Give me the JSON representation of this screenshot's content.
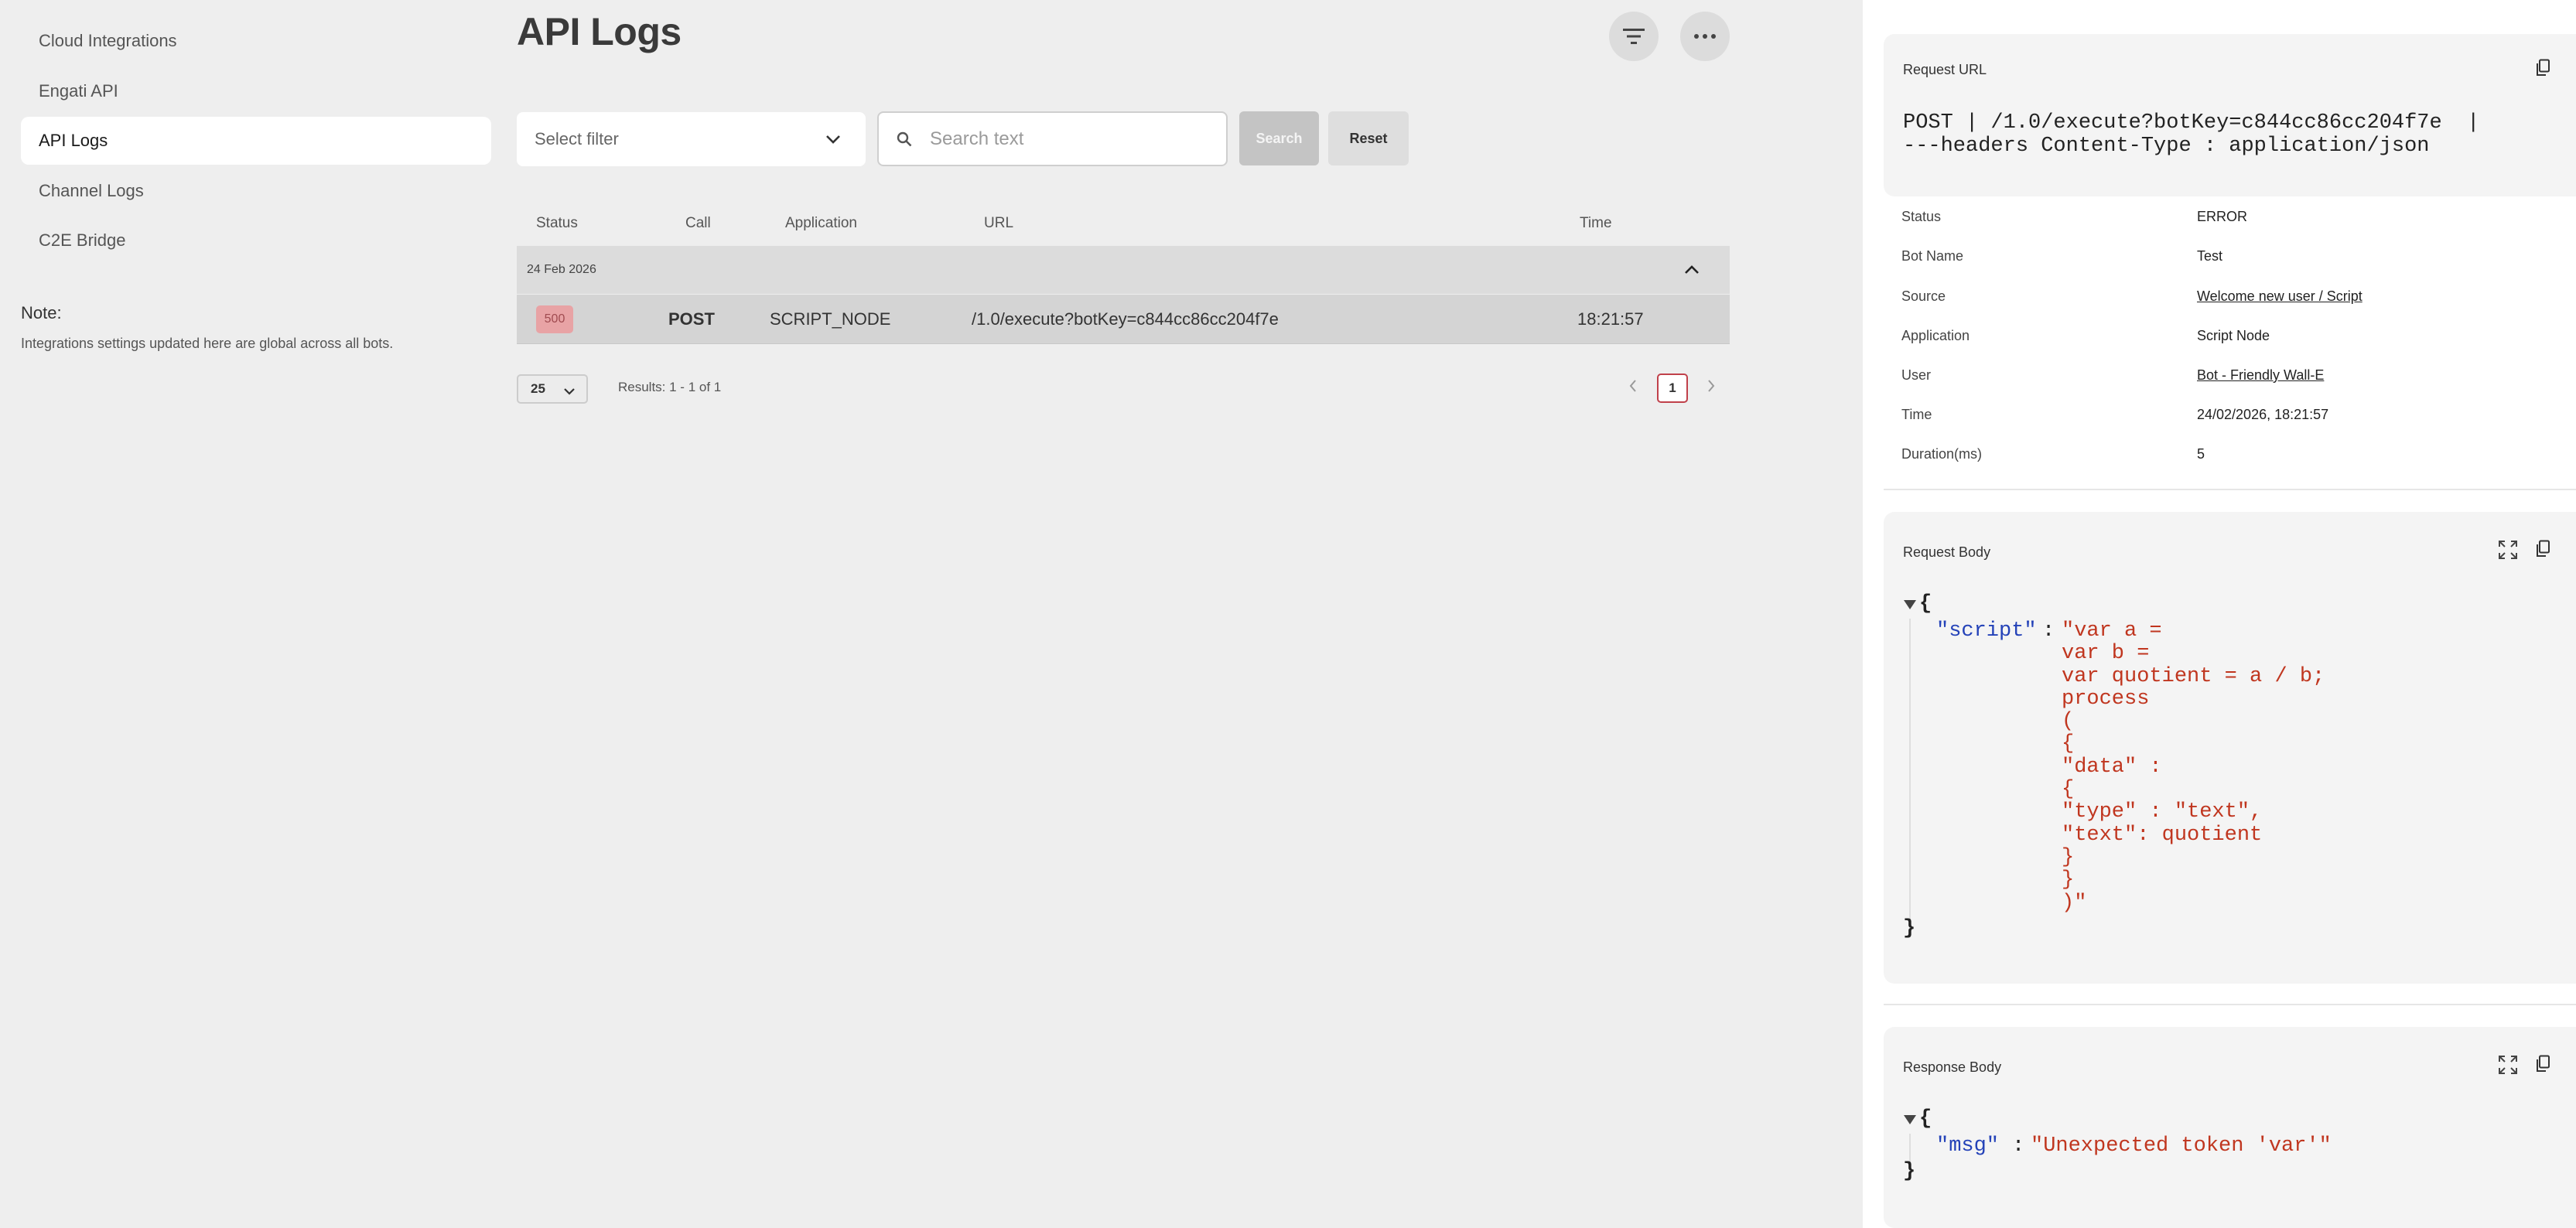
{
  "sidebar": {
    "items": [
      {
        "label": "Cloud Integrations"
      },
      {
        "label": "Engati API"
      },
      {
        "label": "API Logs"
      },
      {
        "label": "Channel Logs"
      },
      {
        "label": "C2E Bridge"
      }
    ],
    "active_index": 2,
    "note_title": "Note:",
    "note_text": "Integrations settings updated here are global across all bots."
  },
  "header": {
    "title": "API Logs",
    "filter_icon": "filter-icon",
    "more_icon": "more-horizontal-icon"
  },
  "filters": {
    "select_placeholder": "Select filter",
    "search_placeholder": "Search text",
    "search_value": "",
    "search_button": "Search",
    "reset_button": "Reset"
  },
  "table": {
    "columns": [
      "Status",
      "Call",
      "Application",
      "URL",
      "Time"
    ],
    "groups": [
      {
        "date": "24 Feb 2026",
        "rows": [
          {
            "status": "500",
            "call": "POST",
            "application": "SCRIPT_NODE",
            "url": "/1.0/execute?botKey=c844cc86cc204f7e",
            "time": "18:21:57"
          }
        ]
      }
    ]
  },
  "pagination": {
    "page_size": "25",
    "results": "Results: 1 - 1 of 1",
    "current_page": "1"
  },
  "detail": {
    "request_url": {
      "title": "Request URL",
      "line1": "POST | /1.0/execute?botKey=c844cc86cc204f7e  |",
      "line2": "---headers Content-Type : application/json"
    },
    "fields": [
      {
        "label": "Status",
        "value": "ERROR",
        "link": false
      },
      {
        "label": "Bot Name",
        "value": "Test",
        "link": false
      },
      {
        "label": "Source",
        "value": "Welcome new user / Script",
        "link": true
      },
      {
        "label": "Application",
        "value": "Script Node",
        "link": false
      },
      {
        "label": "User",
        "value": "Bot - Friendly Wall-E",
        "link": true
      },
      {
        "label": "Time",
        "value": "24/02/2026, 18:21:57",
        "link": false
      },
      {
        "label": "Duration(ms)",
        "value": "5",
        "link": false
      }
    ],
    "request_body": {
      "title": "Request Body",
      "open_brace": "{",
      "close_brace": "}",
      "key": "\"script\"",
      "colon": ":",
      "value": "\"var a = \nvar b = \nvar quotient = a / b;\nprocess\n(\n{\n\"data\" :\n{\n\"type\" : \"text\",\n\"text\": quotient\n}\n}\n)\""
    },
    "response_body": {
      "title": "Response Body",
      "open_brace": "{",
      "close_brace": "}",
      "key": "\"msg\"",
      "colon": ":",
      "value": "\"Unexpected token 'var'\""
    }
  },
  "colors": {
    "accent": "#c0404a",
    "status_badge_bg": "#e8a3a5",
    "json_key": "#2442b8",
    "json_string": "#c0361f"
  }
}
